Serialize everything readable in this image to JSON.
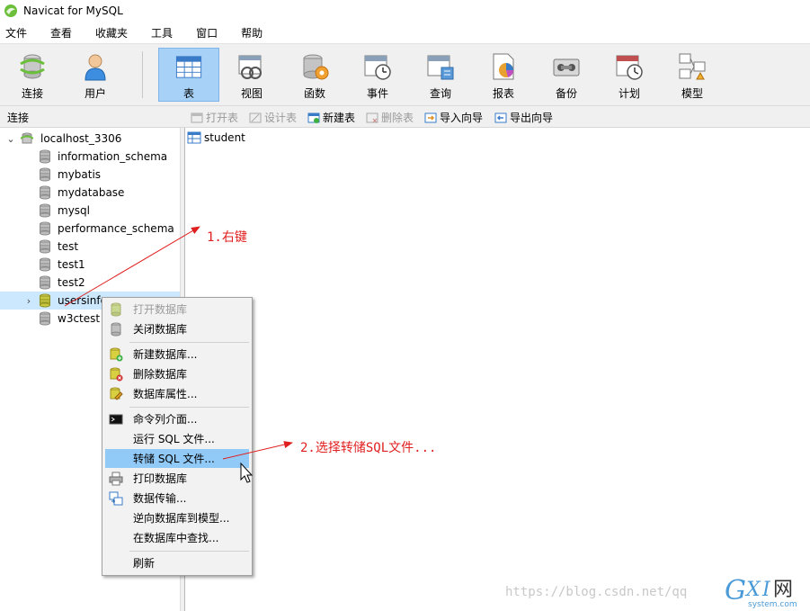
{
  "window": {
    "title": "Navicat for MySQL"
  },
  "menu": [
    "文件",
    "查看",
    "收藏夹",
    "工具",
    "窗口",
    "帮助"
  ],
  "toolbar": {
    "items": [
      {
        "label": "连接",
        "icon": "connection-icon"
      },
      {
        "label": "用户",
        "icon": "user-icon"
      },
      {
        "label": "表",
        "icon": "table-icon",
        "active": true
      },
      {
        "label": "视图",
        "icon": "view-icon"
      },
      {
        "label": "函数",
        "icon": "function-icon"
      },
      {
        "label": "事件",
        "icon": "event-icon"
      },
      {
        "label": "查询",
        "icon": "query-icon"
      },
      {
        "label": "报表",
        "icon": "report-icon"
      },
      {
        "label": "备份",
        "icon": "backup-icon"
      },
      {
        "label": "计划",
        "icon": "schedule-icon"
      },
      {
        "label": "模型",
        "icon": "model-icon"
      }
    ]
  },
  "subbar": {
    "connection_label": "连接",
    "buttons": [
      {
        "label": "打开表",
        "enabled": false
      },
      {
        "label": "设计表",
        "enabled": false
      },
      {
        "label": "新建表",
        "enabled": true
      },
      {
        "label": "删除表",
        "enabled": false
      },
      {
        "label": "导入向导",
        "enabled": true
      },
      {
        "label": "导出向导",
        "enabled": true
      }
    ]
  },
  "tree": {
    "connection": "localhost_3306",
    "databases": [
      "information_schema",
      "mybatis",
      "mydatabase",
      "mysql",
      "performance_schema",
      "test",
      "test1",
      "test2",
      "usersinfo",
      "w3ctest"
    ],
    "selected": "usersinfo"
  },
  "tables": [
    "student"
  ],
  "context_menu": {
    "items": [
      {
        "label": "打开数据库",
        "enabled": false,
        "icon": "db-open-icon"
      },
      {
        "label": "关闭数据库",
        "enabled": true,
        "icon": "db-close-icon"
      },
      {
        "label": "新建数据库...",
        "enabled": true,
        "icon": "db-new-icon"
      },
      {
        "label": "删除数据库",
        "enabled": true,
        "icon": "db-delete-icon"
      },
      {
        "label": "数据库属性...",
        "enabled": true,
        "icon": "db-properties-icon"
      },
      {
        "label": "命令列介面...",
        "enabled": true,
        "icon": "console-icon"
      },
      {
        "label": "运行 SQL 文件...",
        "enabled": true,
        "icon": ""
      },
      {
        "label": "转储 SQL 文件...",
        "enabled": true,
        "icon": "",
        "highlighted": true
      },
      {
        "label": "打印数据库",
        "enabled": true,
        "icon": "printer-icon"
      },
      {
        "label": "数据传输...",
        "enabled": true,
        "icon": "transfer-icon"
      },
      {
        "label": "逆向数据库到模型...",
        "enabled": true,
        "icon": ""
      },
      {
        "label": "在数据库中查找...",
        "enabled": true,
        "icon": ""
      },
      {
        "label": "刷新",
        "enabled": true,
        "icon": ""
      }
    ]
  },
  "annotations": {
    "step1": "1.右键",
    "step2": "2.选择转储SQL文件...",
    "color": "#e02020"
  },
  "watermark": {
    "url": "https://blog.csdn.net/qq",
    "logo_text": "GXI网",
    "logo_sub": "system.com"
  }
}
